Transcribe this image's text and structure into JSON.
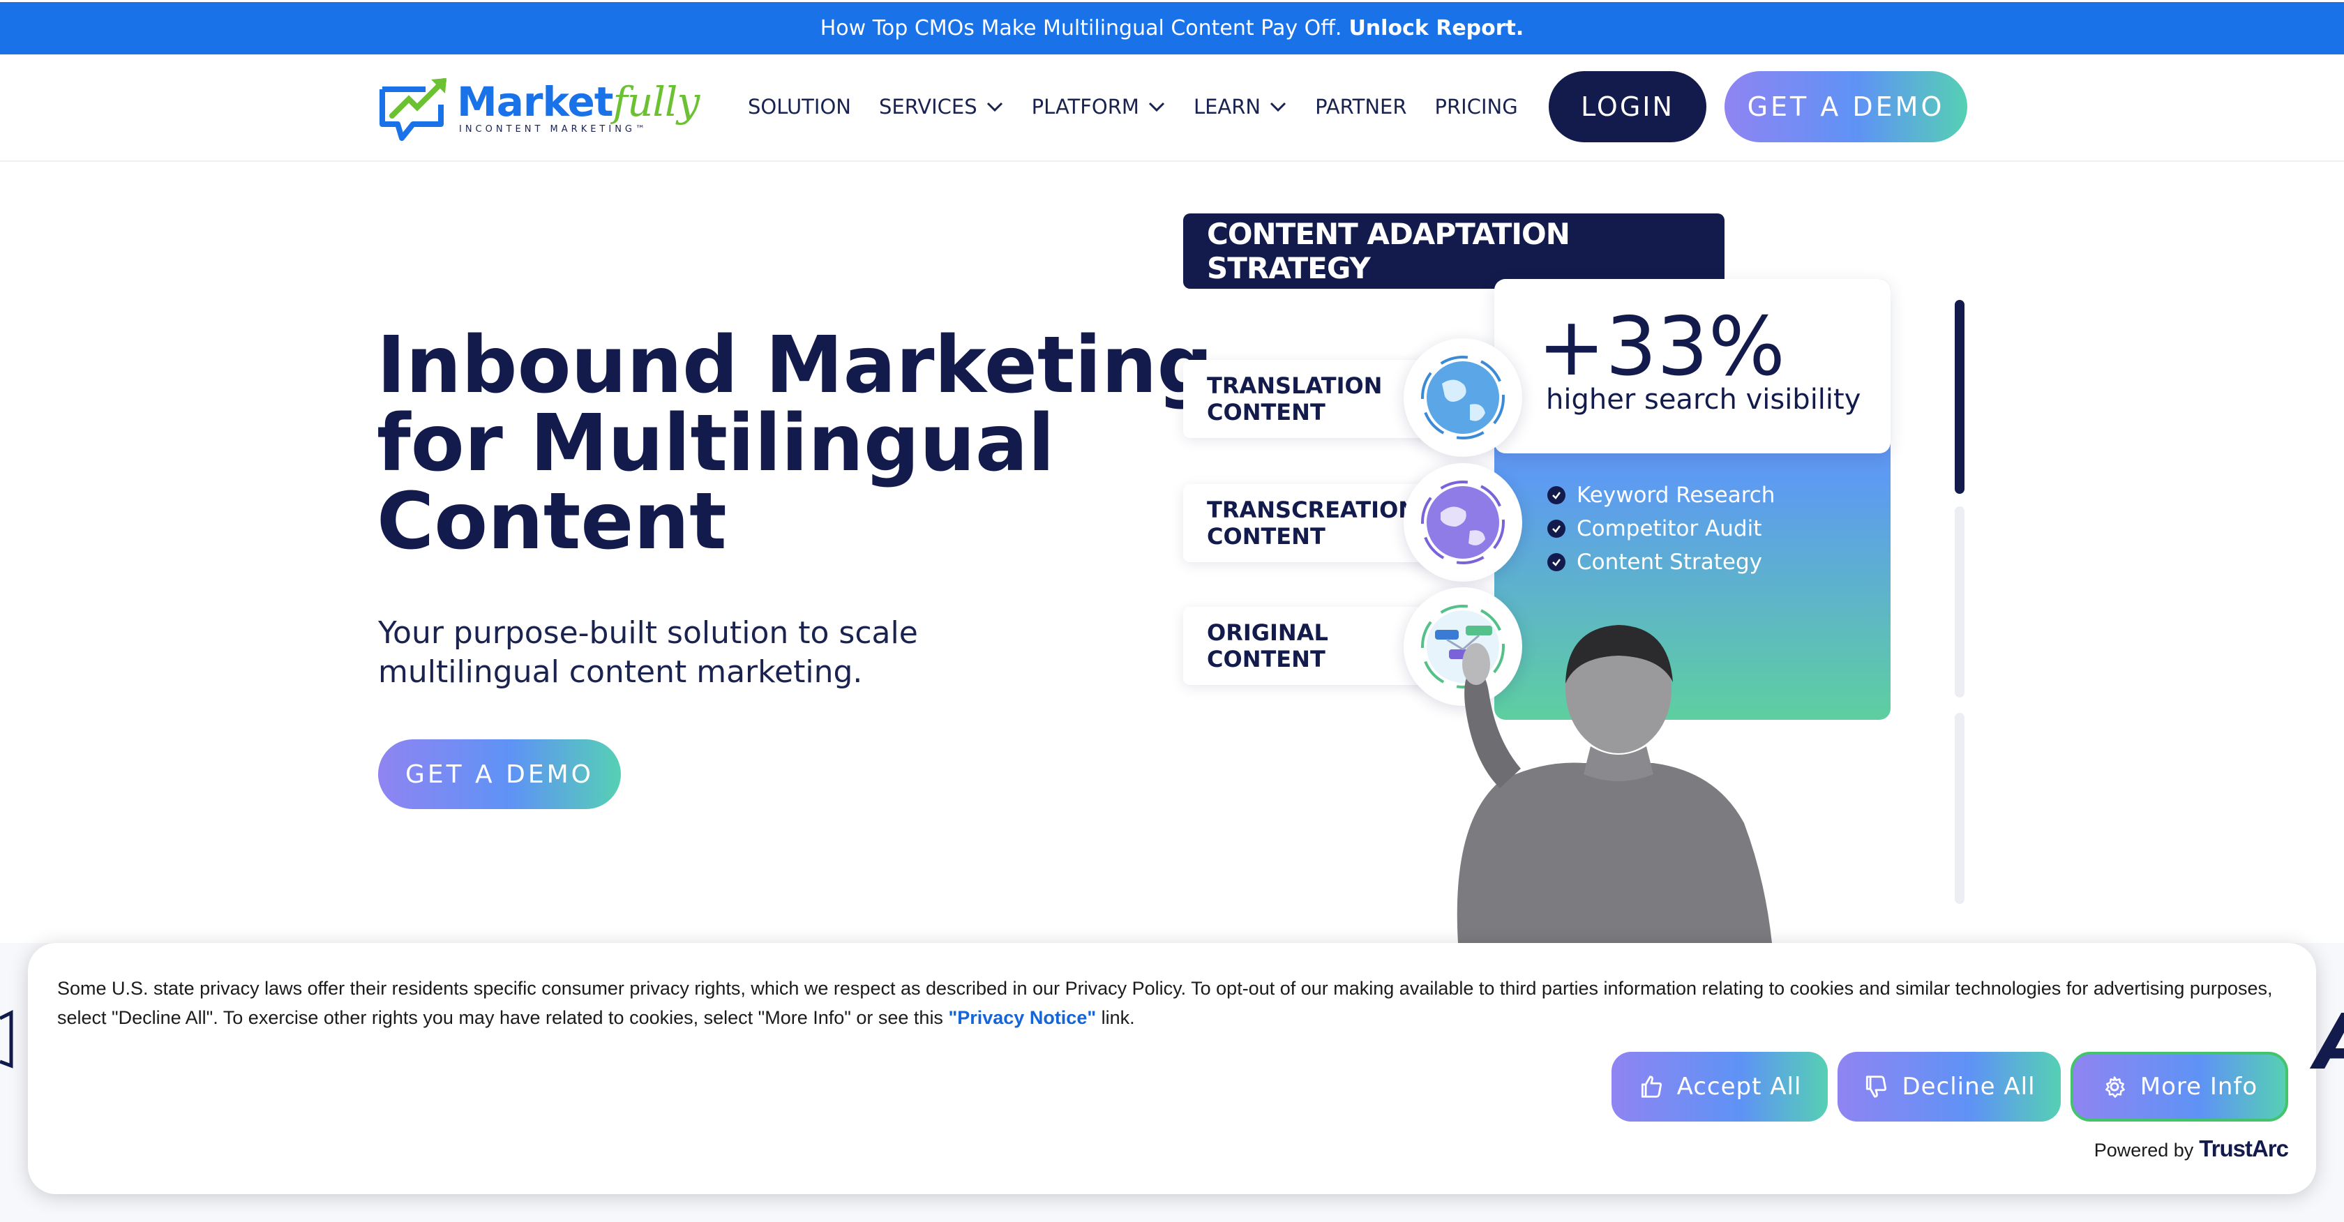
{
  "announcement": {
    "text": "How Top CMOs Make Multilingual Content Pay Off.",
    "link": "Unlock Report."
  },
  "header": {
    "logo": {
      "main": "Market",
      "accent": "fully",
      "tagline": "INCONTENT MARKETING™"
    },
    "nav": [
      {
        "label": "SOLUTION",
        "dropdown": false
      },
      {
        "label": "SERVICES",
        "dropdown": true
      },
      {
        "label": "PLATFORM",
        "dropdown": true
      },
      {
        "label": "LEARN",
        "dropdown": true
      },
      {
        "label": "PARTNER",
        "dropdown": false
      },
      {
        "label": "PRICING",
        "dropdown": false
      }
    ],
    "login_label": "LOGIN",
    "demo_label": "GET A DEMO"
  },
  "hero": {
    "title_lines": [
      "Inbound Marketing",
      "for Multilingual",
      "Content"
    ],
    "subtitle_lines": [
      "Your purpose-built solution to scale",
      "multilingual content marketing."
    ],
    "cta_label": "GET A DEMO"
  },
  "graphic": {
    "strategy_title": "CONTENT ADAPTATION STRATEGY",
    "stat_value": "+33%",
    "stat_label": "higher search visibility",
    "checklist": [
      "Keyword Research",
      "Competitor Audit",
      "Content Strategy"
    ],
    "cards": [
      {
        "line1": "TRANSLATION",
        "line2": "CONTENT",
        "icon": "globe-icon"
      },
      {
        "line1": "TRANSCREATION",
        "line2": "CONTENT",
        "icon": "globe-icon"
      },
      {
        "line1": "ORIGINAL",
        "line2": "CONTENT",
        "icon": "network-icon"
      }
    ]
  },
  "cookie": {
    "text_before": "Some U.S. state privacy laws offer their residents specific consumer privacy rights, which we respect as described in our Privacy Policy. To opt-out of our making available to third parties information relating to cookies and similar technologies for advertising purposes, select \"Decline All\". To exercise other rights you may have related to cookies, select \"More Info\" or see this ",
    "link_text": "\"Privacy Notice\"",
    "text_after": " link.",
    "accept_label": "Accept All",
    "decline_label": "Decline All",
    "more_label": "More Info",
    "powered_by": "Powered by",
    "powered_brand": "TrustArc"
  },
  "colors": {
    "announce_bg": "#1a72e8",
    "navy": "#131b4d",
    "gradient_start": "#8f84f2",
    "gradient_mid": "#5e93f5",
    "gradient_end": "#56d0b4",
    "logo_green": "#6cc133"
  }
}
